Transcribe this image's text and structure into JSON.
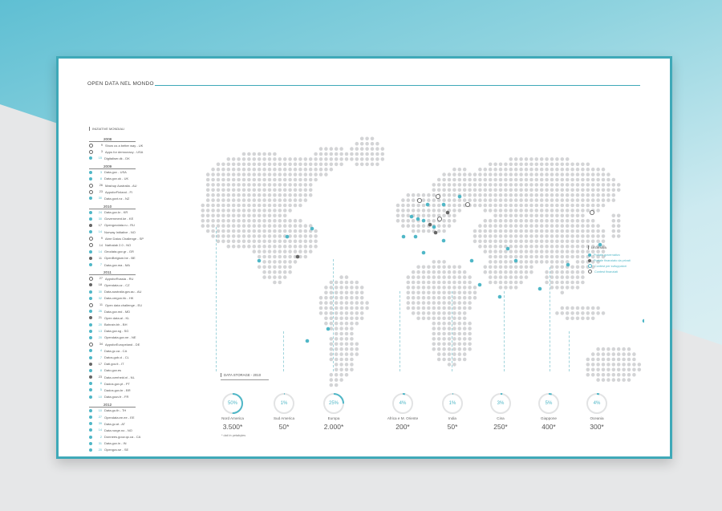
{
  "title": "OPEN DATA NEL MONDO",
  "sidebar": {
    "header": "INIZIATIVE MONDIALI",
    "groups": [
      {
        "year": "2008",
        "items": [
          {
            "n": "9",
            "t": "Show us a better way - UK",
            "k": "con"
          },
          {
            "n": "3",
            "t": "Apps for democracy - USA",
            "k": "con"
          },
          {
            "n": "15",
            "t": "Digitaliser.dk - DK",
            "k": "gov"
          }
        ]
      },
      {
        "year": "2009",
        "items": [
          {
            "n": "3",
            "t": "Data.gov - USA",
            "k": "gov"
          },
          {
            "n": "8",
            "t": "Data.gov.uk - UK",
            "k": "gov"
          },
          {
            "n": "26",
            "t": "Mashup Australia - AU",
            "k": "con"
          },
          {
            "n": "23",
            "t": "AppsforFinland - FI",
            "k": "con"
          },
          {
            "n": "30",
            "t": "Data.govt.nz - NZ",
            "k": "gov"
          }
        ]
      },
      {
        "year": "2010",
        "items": [
          {
            "n": "24",
            "t": "Data.gov.kr - KR",
            "k": "gov"
          },
          {
            "n": "30",
            "t": "Government.ke - KE",
            "k": "gov"
          },
          {
            "n": "17",
            "t": "Opengovdata.ru - RU",
            "k": "bus"
          },
          {
            "n": "14",
            "t": "Norway Initiative - NO",
            "k": "gov"
          },
          {
            "n": "9",
            "t": "Abre Datos Challenge - SP",
            "k": "con"
          },
          {
            "n": "14",
            "t": "Nathalab 2.0 - NO",
            "k": "con"
          },
          {
            "n": "14",
            "t": "Geodata.gov.gr - GR",
            "k": "gov"
          },
          {
            "n": "11",
            "t": "OpenBelgium.be - BE",
            "k": "bus"
          },
          {
            "n": "7",
            "t": "Data.gov.ma - MA",
            "k": "gov"
          }
        ]
      },
      {
        "year": "2011",
        "items": [
          {
            "n": "27",
            "t": "AppsforRussia - RU",
            "k": "con"
          },
          {
            "n": "18",
            "t": "Opendata.cz - CZ",
            "k": "bus"
          },
          {
            "n": "30",
            "t": "Data.australia.gov.au - AU",
            "k": "gov"
          },
          {
            "n": "32",
            "t": "Data.oregon.hk - HK",
            "k": "gov"
          },
          {
            "n": "11",
            "t": "Open data challenge - EU",
            "k": "con"
          },
          {
            "n": "26",
            "t": "Data.gov.md - MD",
            "k": "gov"
          },
          {
            "n": "21",
            "t": "Open data.al - KL",
            "k": "bus"
          },
          {
            "n": "20",
            "t": "Bahrain.bh - BH",
            "k": "gov"
          },
          {
            "n": "13",
            "t": "Data.gov.sg - SG",
            "k": "gov"
          },
          {
            "n": "20",
            "t": "Opendata.gov.ne - NE",
            "k": "gov"
          },
          {
            "n": "34",
            "t": "AppsforEuropeland - DE",
            "k": "con"
          },
          {
            "n": "4",
            "t": "Data.gc.ca - CA",
            "k": "gov"
          },
          {
            "n": "7",
            "t": "Datos.gob.cl - CL",
            "k": "gov"
          },
          {
            "n": "17",
            "t": "Dati.gov.it - IT",
            "k": "bus"
          },
          {
            "n": "8",
            "t": "Dato.gov.es",
            "k": "gov"
          },
          {
            "n": "23",
            "t": "Data.overheid.nl - NL",
            "k": "bus"
          },
          {
            "n": "8",
            "t": "Dados.gov.pt - PT",
            "k": "gov"
          },
          {
            "n": "5",
            "t": "Dados.gov.br - BR",
            "k": "gov"
          },
          {
            "n": "10",
            "t": "Data.gouv.fr - FR",
            "k": "gov"
          }
        ]
      },
      {
        "year": "2012",
        "items": [
          {
            "n": "10",
            "t": "Data.go.th - TH",
            "k": "gov"
          },
          {
            "n": "27",
            "t": "Opendata.ee.ee - EE",
            "k": "gov"
          },
          {
            "n": "39",
            "t": "Data.gv.at - AT",
            "k": "gov"
          },
          {
            "n": "14",
            "t": "Data.norge.no - NO",
            "k": "gov"
          },
          {
            "n": "2",
            "t": "Donnees.gouv.qc.ca - CA",
            "k": "gov"
          },
          {
            "n": "31",
            "t": "Data.gov.in - IN",
            "k": "gov"
          },
          {
            "n": "20",
            "t": "Opengov.se - SE",
            "k": "gov"
          }
        ]
      }
    ]
  },
  "legend": {
    "title": "LEGENDA",
    "items": [
      {
        "label": "Portale governativo",
        "k": "gov"
      },
      {
        "label": "Portale finanziato da privati",
        "k": "bus"
      },
      {
        "label": "Contest per sviluppatori",
        "k": "lab"
      },
      {
        "label": "Contest finanziati",
        "k": "con"
      }
    ]
  },
  "data_storage": {
    "label": "DATA STORAGE - 2010",
    "footnote": "* dati in petabytes",
    "regions": [
      {
        "name": "Nord America",
        "pct": "50%",
        "value": "3.500*"
      },
      {
        "name": "Sud America",
        "pct": "1%",
        "value": "50*"
      },
      {
        "name": "Europa",
        "pct": "25%",
        "value": "2.000*"
      },
      {
        "name": "Africa e M. Oriente",
        "pct": "4%",
        "value": "200*"
      },
      {
        "name": "India",
        "pct": "1%",
        "value": "50*"
      },
      {
        "name": "Cina",
        "pct": "3%",
        "value": "250*"
      },
      {
        "name": "Giappone",
        "pct": "5%",
        "value": "400*"
      },
      {
        "name": "Oceania",
        "pct": "4%",
        "value": "300*"
      }
    ]
  },
  "colors": {
    "accent": "#4fb7c7",
    "dark": "#666666",
    "dot": "#d3d4d6"
  }
}
